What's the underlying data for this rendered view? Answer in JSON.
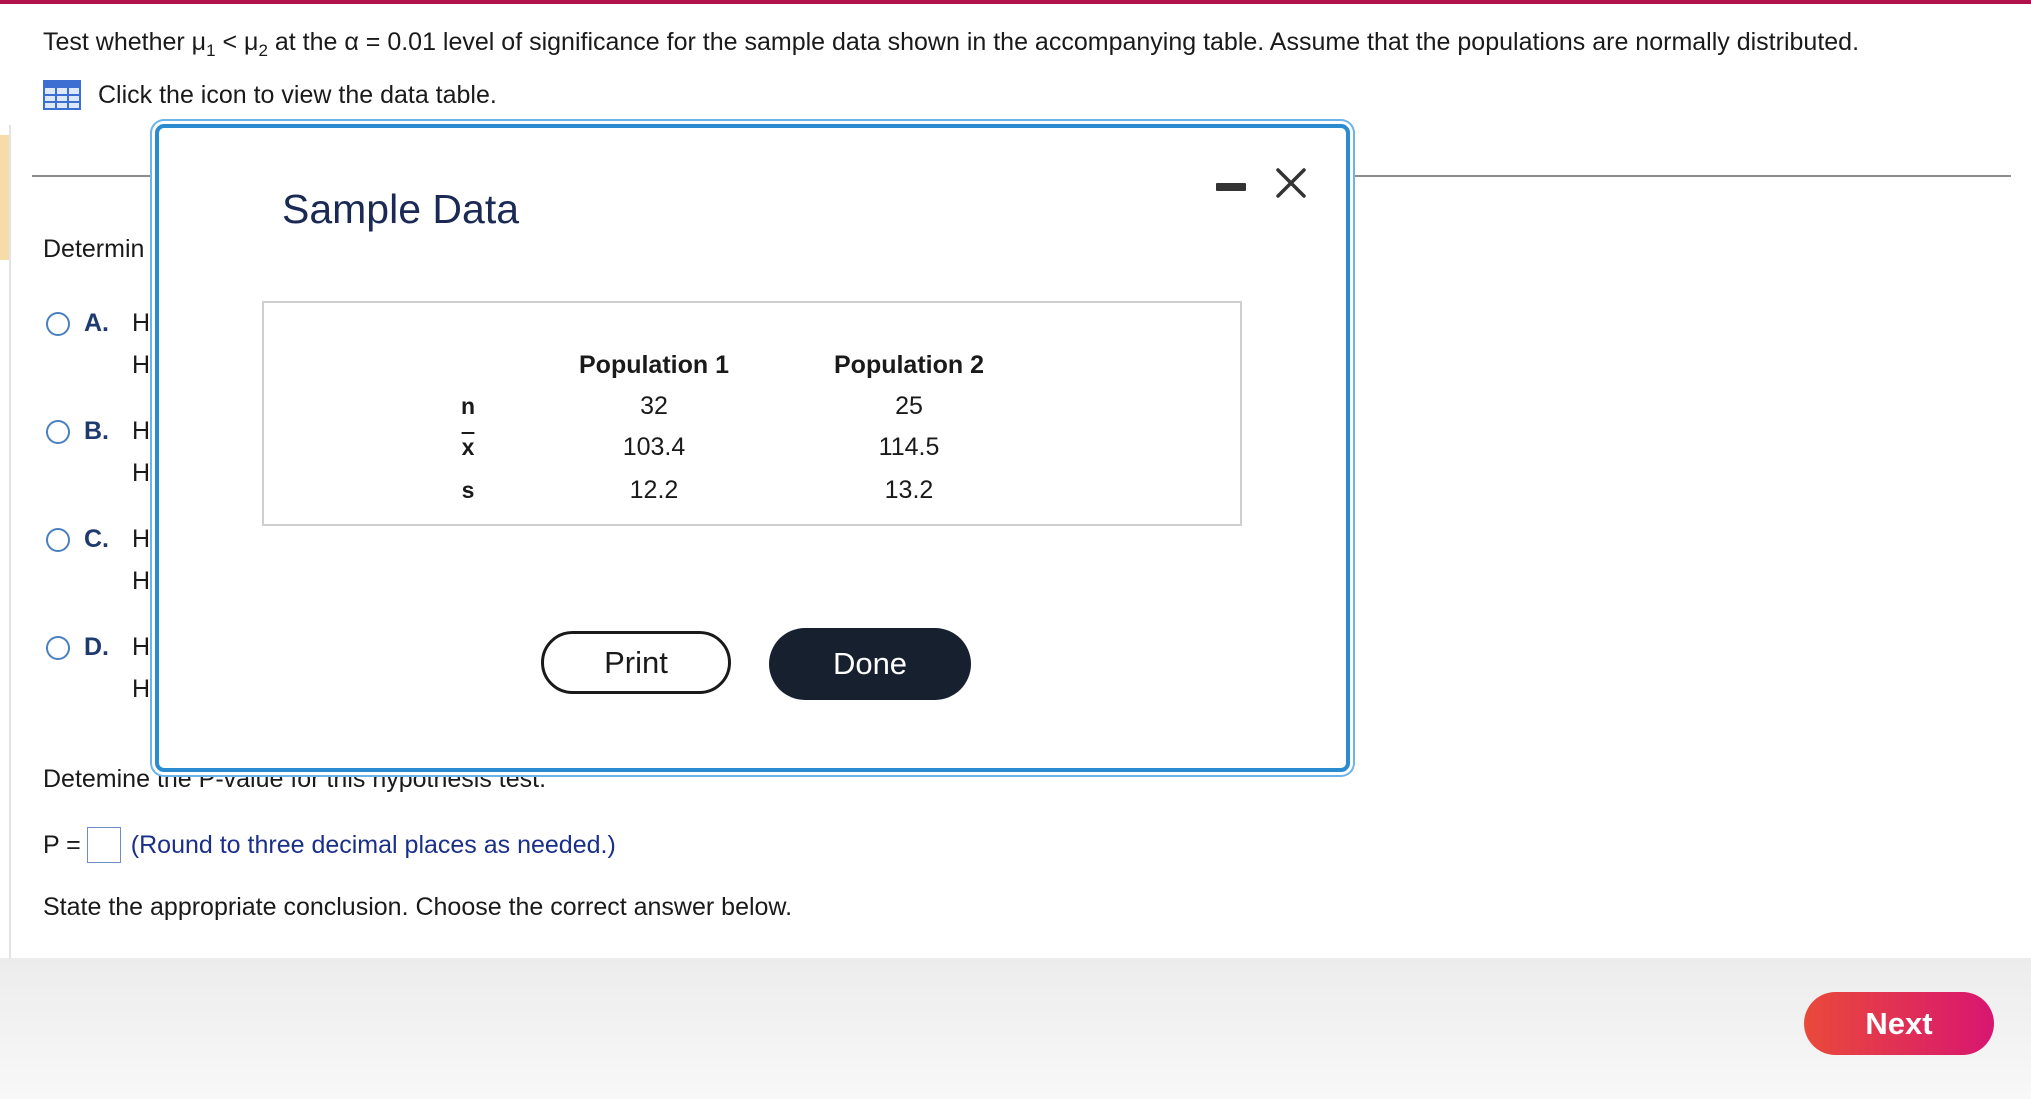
{
  "question": {
    "prefix": "Test whether μ",
    "sub1": "1",
    "lt": " < μ",
    "sub2": "2",
    "suffix": " at the α = 0.01 level of significance for the sample data shown in the accompanying table. Assume that the populations are normally distributed."
  },
  "table_link": {
    "text": "Click the icon to view the data table.",
    "icon": "table-grid-icon"
  },
  "determine_label": "Determin",
  "options": [
    {
      "letter": "A.",
      "line1": "H",
      "line2": "H"
    },
    {
      "letter": "B.",
      "line1": "H",
      "line2": "H"
    },
    {
      "letter": "C.",
      "line1": "H",
      "line2": "H"
    },
    {
      "letter": "D.",
      "line1": "H",
      "line2": "H"
    }
  ],
  "pvalue_text": "Detemine the P-value for this hypothesis test.",
  "p_label": "P =",
  "p_hint": "(Round to three decimal places as needed.)",
  "conclusion_text": "State the appropriate conclusion. Choose the correct answer below.",
  "next_label": "Next",
  "modal": {
    "title": "Sample Data",
    "minimize_icon": "minimize-icon",
    "close_icon": "close-icon",
    "columns": [
      "Population 1",
      "Population 2"
    ],
    "rows": [
      {
        "label": "n",
        "values": [
          "32",
          "25"
        ]
      },
      {
        "label": "x",
        "values": [
          "103.4",
          "114.5"
        ]
      },
      {
        "label": "s",
        "values": [
          "12.2",
          "13.2"
        ]
      }
    ],
    "print_label": "Print",
    "done_label": "Done"
  },
  "colors": {
    "accent_bar": "#b0124a",
    "modal_border": "#2a8bd1",
    "done_bg": "#16202f",
    "next_start": "#e94a3a",
    "next_end": "#d81670"
  }
}
